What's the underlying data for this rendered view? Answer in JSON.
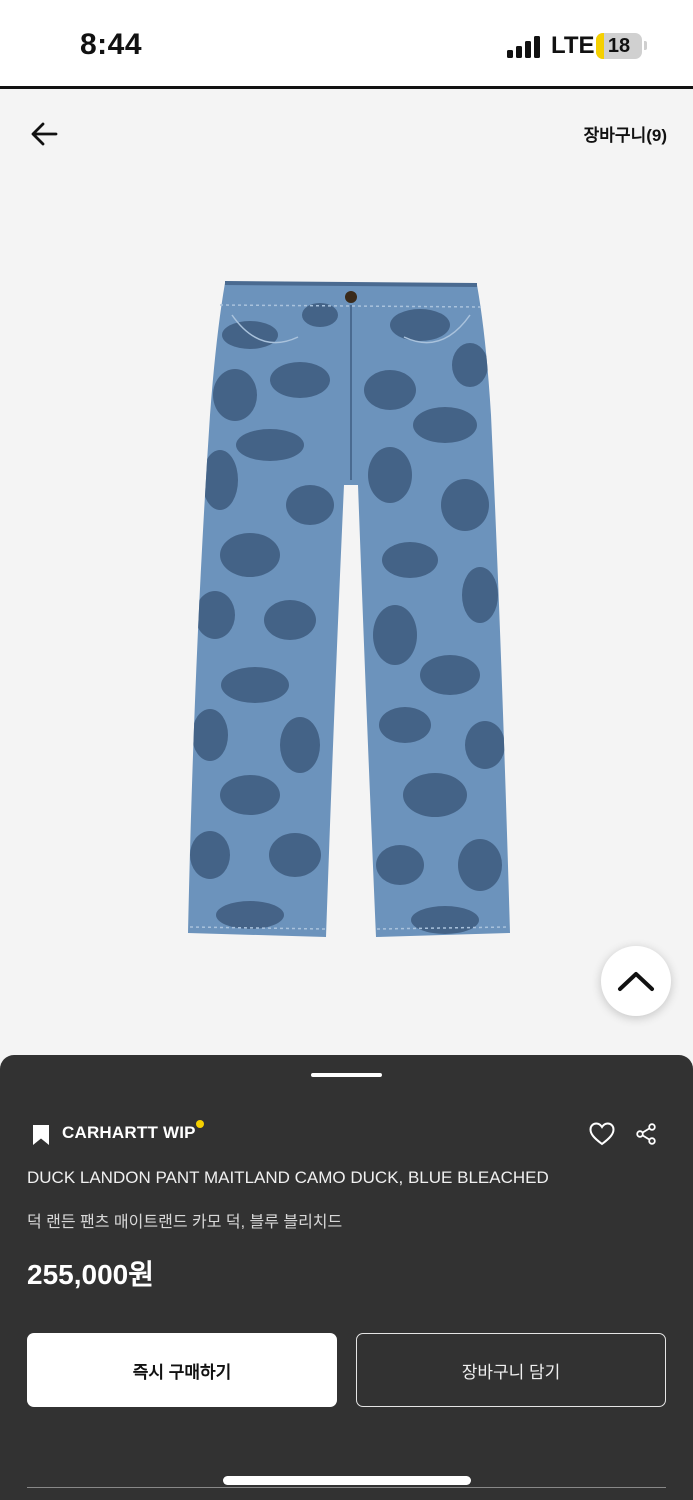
{
  "status_bar": {
    "time": "8:44",
    "network": "LTE",
    "battery": "18",
    "battery_level_percent": 18
  },
  "header": {
    "cart_label": "장바구니(9)"
  },
  "product": {
    "brand": "CARHARTT WIP",
    "name_en": "DUCK LANDON PANT MAITLAND CAMO DUCK, BLUE BLEACHED",
    "name_ko": "덕 랜든 팬츠 매이트랜드 카모 덕, 블루 블리치드",
    "price": "255,000원"
  },
  "actions": {
    "buy_now_label": "즉시 구매하기",
    "add_to_cart_label": "장바구니 담기"
  },
  "icons": {
    "back": "arrow-left-icon",
    "scroll_top": "chevron-up-icon",
    "bookmark": "bookmark-icon",
    "wishlist": "heart-icon",
    "share": "share-icon"
  },
  "colors": {
    "sheet_bg": "#323232",
    "brand_dot": "#f5d000",
    "background": "#f4f4f4",
    "denim": "#6c93bc"
  }
}
